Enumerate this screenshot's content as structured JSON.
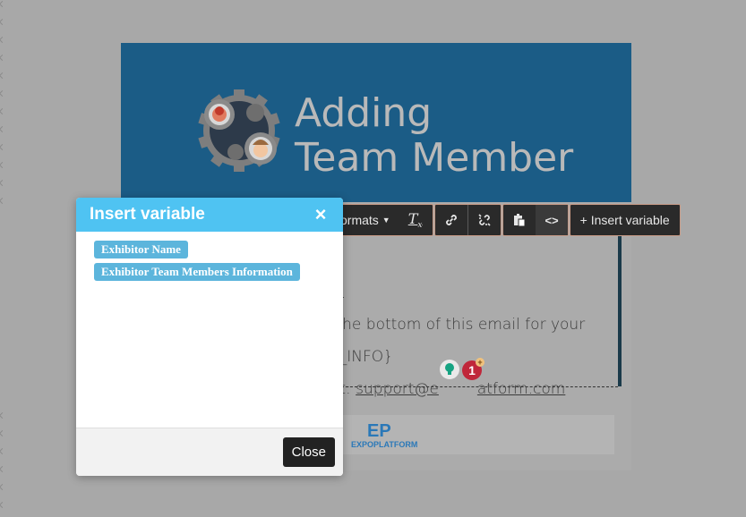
{
  "email": {
    "header_title_line1": "Adding",
    "header_title_line2": "Team Member",
    "body_lines": [
      "er.",
      "at the bottom of this email for your",
      "S_INFO}"
    ],
    "contact_prefix": "ct: ",
    "contact_email_visible": "support@e",
    "contact_email_tail": "atform.com",
    "footer_logo_text": "EXPOPLATFORM",
    "footer_logo_mark": "EP",
    "colors": {
      "banner": "#1b5c86",
      "card": "#ababab",
      "footer_logo": "#2a78b8"
    }
  },
  "toolbar": {
    "formats_label": "ormats",
    "insert_variable_label": "+ Insert variable",
    "icons": [
      "clear-format-icon",
      "link-icon",
      "unlink-icon",
      "paste-icon",
      "code-icon"
    ]
  },
  "grammarly": {
    "badge_count": "1",
    "colors": {
      "badge": "#c0273a",
      "bulb": "#15a382"
    }
  },
  "dialog": {
    "title": "Insert variable",
    "close_symbol": "×",
    "variables": [
      "Exhibitor Name",
      "Exhibitor Team Members Information"
    ],
    "close_button_label": "Close",
    "colors": {
      "header": "#4fc3f2",
      "chip": "#5cb5dc"
    }
  }
}
